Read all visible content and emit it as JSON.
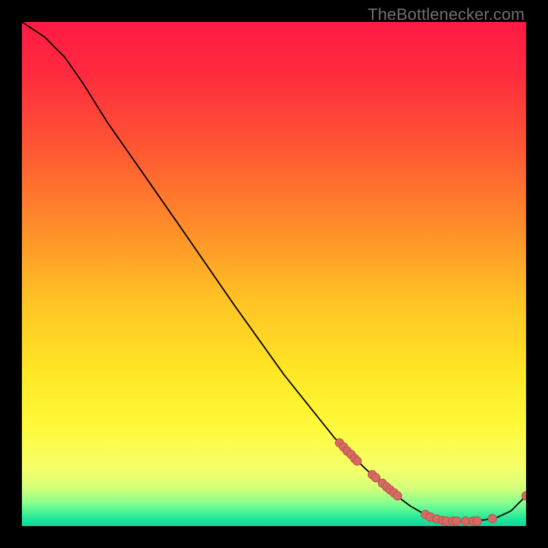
{
  "watermark": "TheBottlenecker.com",
  "colors": {
    "gradient_stops": [
      {
        "offset": 0.0,
        "color": "#ff1a44"
      },
      {
        "offset": 0.1,
        "color": "#ff2a3f"
      },
      {
        "offset": 0.25,
        "color": "#ff5733"
      },
      {
        "offset": 0.4,
        "color": "#ff8a2a"
      },
      {
        "offset": 0.55,
        "color": "#ffc225"
      },
      {
        "offset": 0.7,
        "color": "#ffe825"
      },
      {
        "offset": 0.8,
        "color": "#fff93a"
      },
      {
        "offset": 0.885,
        "color": "#f6ff6a"
      },
      {
        "offset": 0.925,
        "color": "#d4ff7a"
      },
      {
        "offset": 0.955,
        "color": "#86ff8e"
      },
      {
        "offset": 0.985,
        "color": "#1fe89b"
      },
      {
        "offset": 1.0,
        "color": "#12d59a"
      }
    ],
    "curve": "#000000",
    "marker_fill": "#d46a62",
    "marker_stroke": "#b84f48"
  },
  "chart_data": {
    "type": "line",
    "title": "",
    "xlabel": "",
    "ylabel": "",
    "xlim": [
      0,
      100
    ],
    "ylim": [
      0,
      100
    ],
    "curve": [
      {
        "x": 0.0,
        "y": 100.0
      },
      {
        "x": 4.5,
        "y": 97.0
      },
      {
        "x": 8.5,
        "y": 93.0
      },
      {
        "x": 12.0,
        "y": 88.0
      },
      {
        "x": 17.0,
        "y": 80.0
      },
      {
        "x": 24.0,
        "y": 70.0
      },
      {
        "x": 32.0,
        "y": 58.5
      },
      {
        "x": 42.0,
        "y": 44.0
      },
      {
        "x": 52.0,
        "y": 30.0
      },
      {
        "x": 62.0,
        "y": 17.5
      },
      {
        "x": 68.0,
        "y": 11.5
      },
      {
        "x": 73.0,
        "y": 7.0
      },
      {
        "x": 77.0,
        "y": 4.0
      },
      {
        "x": 80.5,
        "y": 2.0
      },
      {
        "x": 84.0,
        "y": 1.0
      },
      {
        "x": 88.0,
        "y": 1.0
      },
      {
        "x": 91.5,
        "y": 1.2
      },
      {
        "x": 94.0,
        "y": 1.6
      },
      {
        "x": 97.0,
        "y": 3.0
      },
      {
        "x": 100.0,
        "y": 6.0
      }
    ],
    "markers": [
      {
        "x": 63.0,
        "y": 16.5
      },
      {
        "x": 63.8,
        "y": 15.7
      },
      {
        "x": 64.5,
        "y": 14.9
      },
      {
        "x": 65.3,
        "y": 14.2
      },
      {
        "x": 66.0,
        "y": 13.4
      },
      {
        "x": 66.5,
        "y": 12.9
      },
      {
        "x": 69.5,
        "y": 10.2
      },
      {
        "x": 70.2,
        "y": 9.6
      },
      {
        "x": 71.5,
        "y": 8.5
      },
      {
        "x": 72.3,
        "y": 7.8
      },
      {
        "x": 73.0,
        "y": 7.2
      },
      {
        "x": 73.8,
        "y": 6.6
      },
      {
        "x": 74.5,
        "y": 6.0
      },
      {
        "x": 80.0,
        "y": 2.3
      },
      {
        "x": 81.0,
        "y": 1.8
      },
      {
        "x": 82.3,
        "y": 1.4
      },
      {
        "x": 83.5,
        "y": 1.1
      },
      {
        "x": 84.2,
        "y": 1.0
      },
      {
        "x": 85.5,
        "y": 1.0
      },
      {
        "x": 86.2,
        "y": 1.0
      },
      {
        "x": 88.0,
        "y": 1.0
      },
      {
        "x": 89.5,
        "y": 1.0
      },
      {
        "x": 90.3,
        "y": 1.0
      },
      {
        "x": 93.3,
        "y": 1.5
      },
      {
        "x": 100.0,
        "y": 6.0
      }
    ],
    "marker_radius_px": 6.2
  }
}
